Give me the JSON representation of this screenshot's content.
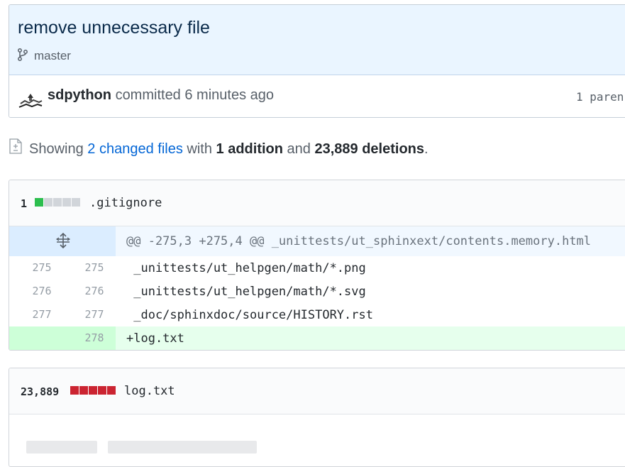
{
  "commit": {
    "title": "remove unnecessary file",
    "branch": "master",
    "author": "sdpython",
    "action": "committed",
    "time": "6 minutes ago",
    "parent_label": "1 paren"
  },
  "summary": {
    "prefix": "Showing",
    "changed_files": "2 changed files",
    "with": "with",
    "additions": "1 addition",
    "and": "and",
    "deletions": "23,889 deletions",
    "period": "."
  },
  "files": [
    {
      "stat": "1",
      "name": ".gitignore",
      "diffstat": [
        "add",
        "neutral",
        "neutral",
        "neutral",
        "neutral"
      ],
      "hunk_header": "@@ -275,3 +275,4 @@ _unittests/ut_sphinxext/contents.memory.html",
      "lines": [
        {
          "old": "275",
          "new": "275",
          "code": " _unittests/ut_helpgen/math/*.png",
          "type": "context"
        },
        {
          "old": "276",
          "new": "276",
          "code": " _unittests/ut_helpgen/math/*.svg",
          "type": "context"
        },
        {
          "old": "277",
          "new": "277",
          "code": " _doc/sphinxdoc/source/HISTORY.rst",
          "type": "context"
        },
        {
          "old": "",
          "new": "278",
          "code": "+log.txt",
          "type": "addition"
        }
      ]
    },
    {
      "stat": "23,889",
      "name": "log.txt",
      "diffstat": [
        "del",
        "del",
        "del",
        "del",
        "del"
      ]
    }
  ],
  "icons": {
    "branch": "git-branch-icon",
    "diff": "file-diff-icon",
    "unfold": "unfold-icon"
  },
  "colors": {
    "link": "#0366d6",
    "addition": "#2cbe4e",
    "deletion": "#cb2431",
    "commit_header_bg": "#eaf5ff"
  }
}
